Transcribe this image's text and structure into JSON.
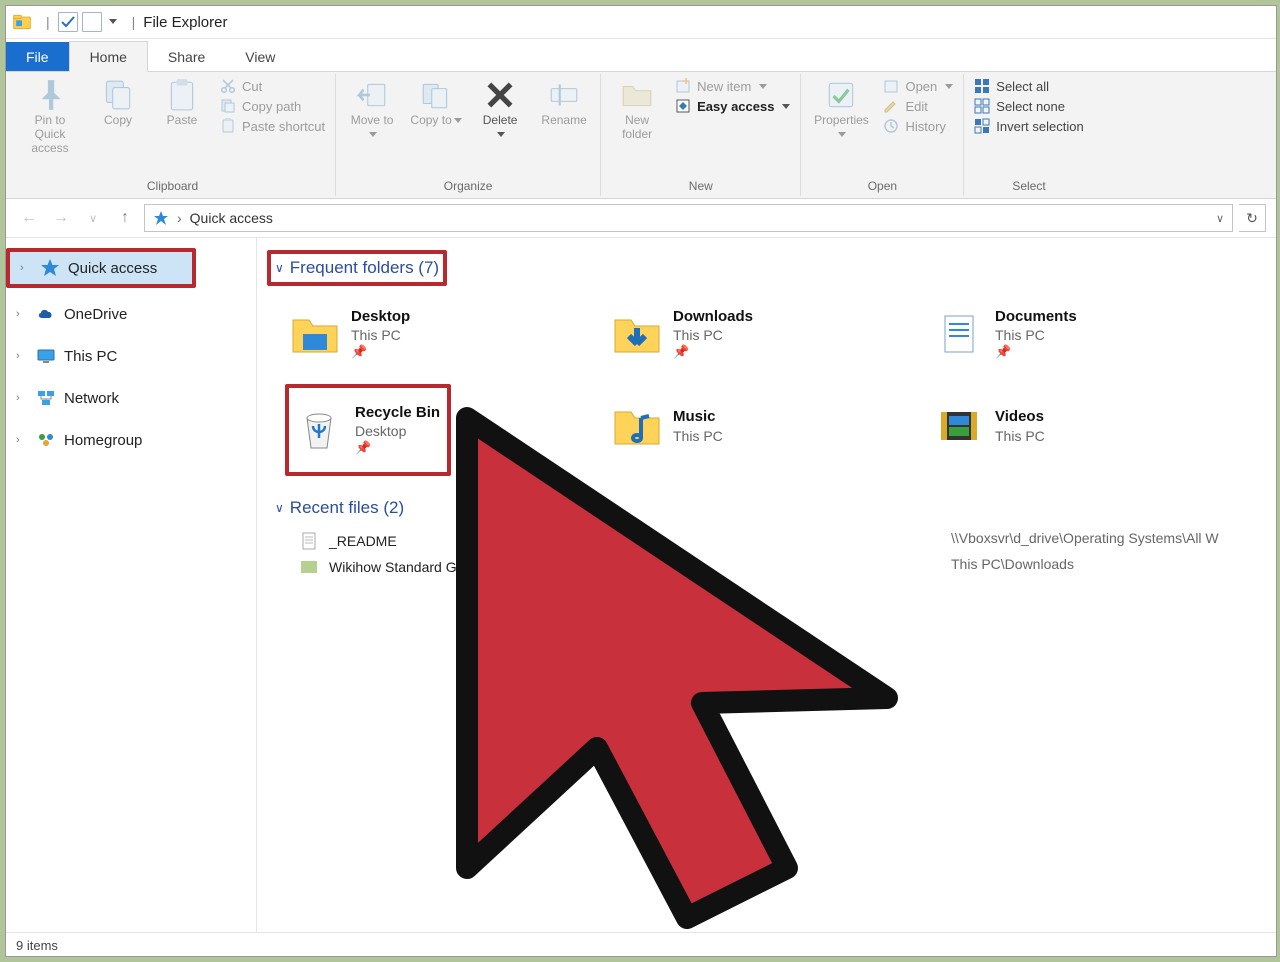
{
  "window": {
    "title": "File Explorer"
  },
  "tabs": {
    "file": "File",
    "home": "Home",
    "share": "Share",
    "view": "View"
  },
  "ribbon": {
    "clipboard": {
      "name": "Clipboard",
      "pin": "Pin to Quick access",
      "copy": "Copy",
      "paste": "Paste",
      "cut": "Cut",
      "copypath": "Copy path",
      "pasteshortcut": "Paste shortcut"
    },
    "organize": {
      "name": "Organize",
      "moveto": "Move to",
      "copyto": "Copy to",
      "delete": "Delete",
      "rename": "Rename"
    },
    "new": {
      "name": "New",
      "newfolder": "New folder",
      "newitem": "New item",
      "easyaccess": "Easy access"
    },
    "open": {
      "name": "Open",
      "properties": "Properties",
      "open": "Open",
      "edit": "Edit",
      "history": "History"
    },
    "select": {
      "name": "Select",
      "all": "Select all",
      "none": "Select none",
      "invert": "Invert selection"
    }
  },
  "address": {
    "location": "Quick access"
  },
  "nav": {
    "items": [
      {
        "label": "Quick access"
      },
      {
        "label": "OneDrive"
      },
      {
        "label": "This PC"
      },
      {
        "label": "Network"
      },
      {
        "label": "Homegroup"
      }
    ]
  },
  "sections": {
    "frequent": "Frequent folders (7)",
    "recent": "Recent files (2)"
  },
  "folders": [
    {
      "name": "Desktop",
      "loc": "This PC"
    },
    {
      "name": "Downloads",
      "loc": "This PC"
    },
    {
      "name": "Documents",
      "loc": "This PC"
    },
    {
      "name": "Recycle Bin",
      "loc": "Desktop"
    },
    {
      "name": "Music",
      "loc": "This PC"
    },
    {
      "name": "Videos",
      "loc": "This PC"
    }
  ],
  "recent": [
    {
      "name": "_README",
      "path": "\\\\Vboxsvr\\d_drive\\Operating Systems\\All W"
    },
    {
      "name": "Wikihow Standard Gr",
      "path": "This PC\\Downloads"
    }
  ],
  "status": {
    "items": "9 items"
  }
}
